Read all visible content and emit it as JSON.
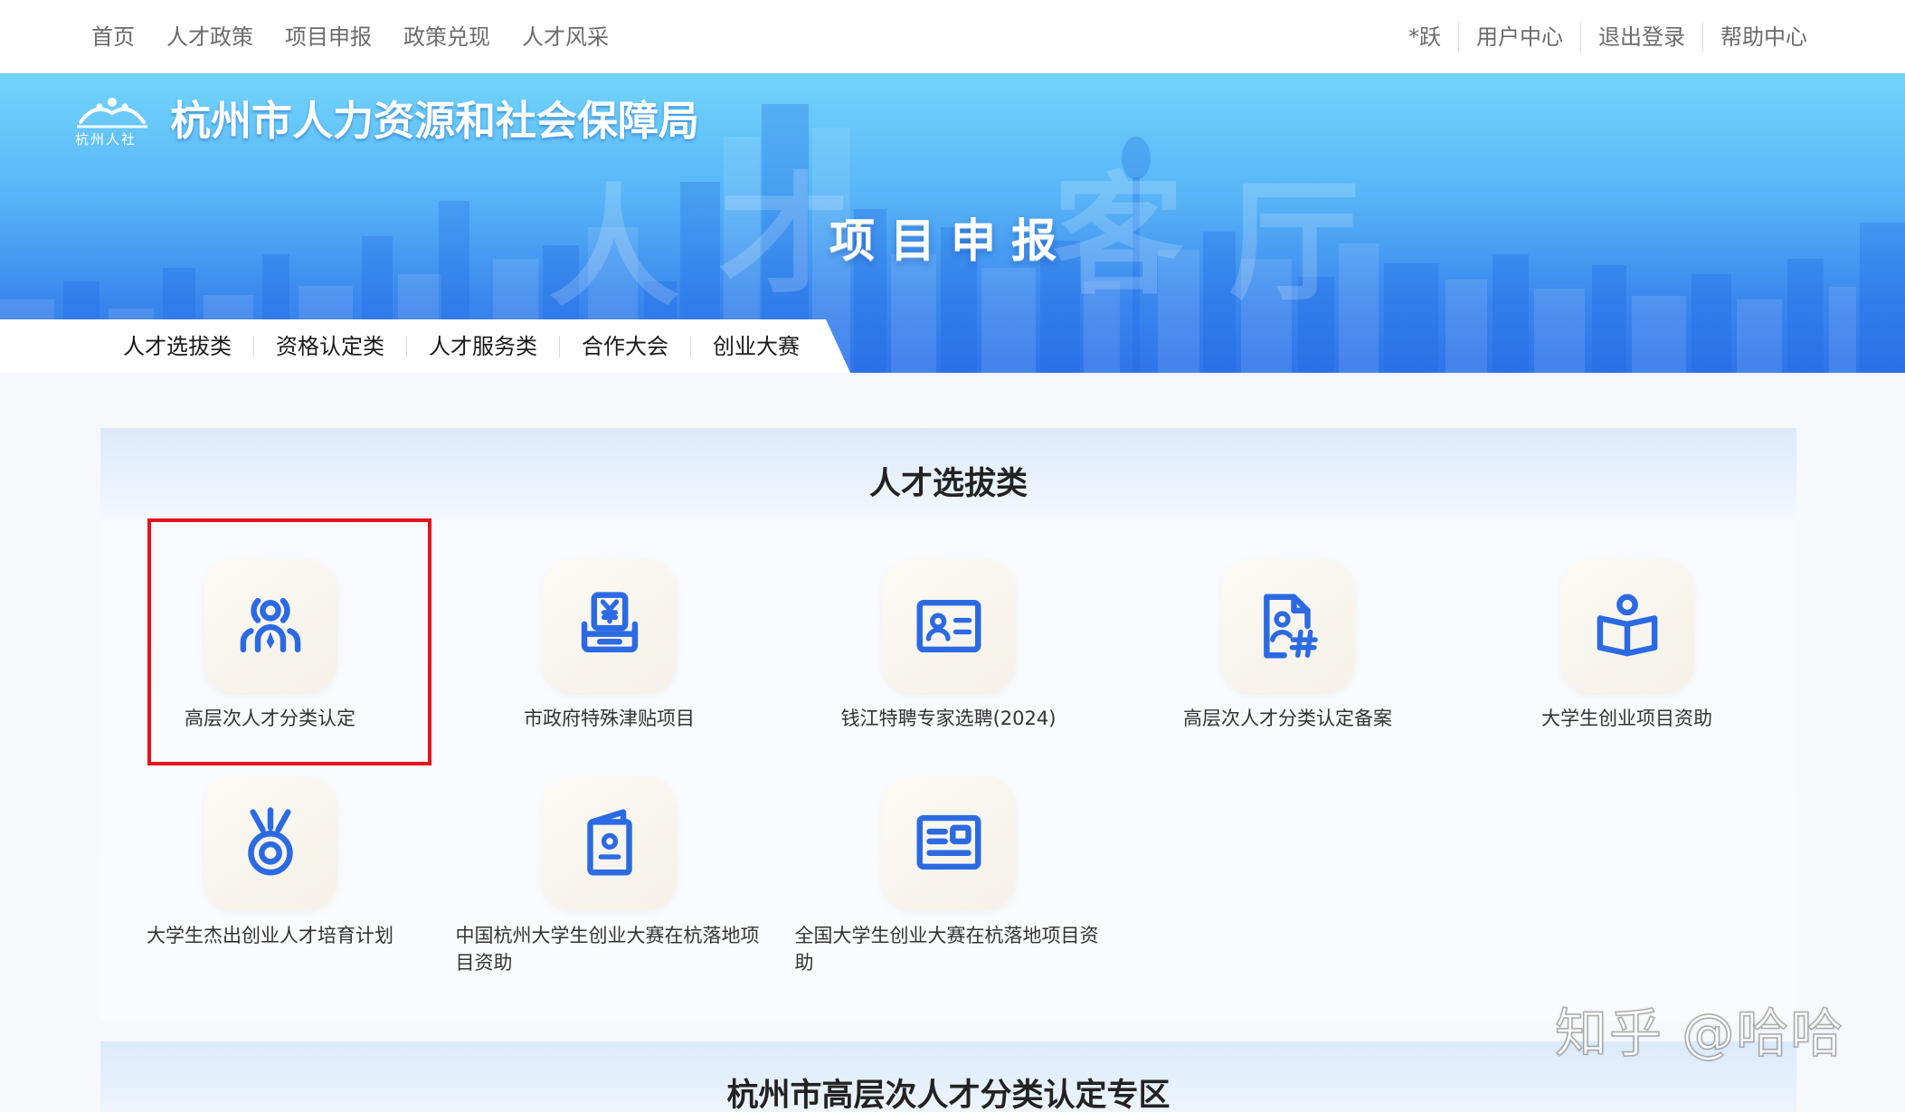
{
  "top_nav": {
    "left_items": [
      "首页",
      "人才政策",
      "项目申报",
      "政策兑现",
      "人才风采"
    ],
    "right_items": [
      "*跃",
      "用户中心",
      "退出登录",
      "帮助中心"
    ]
  },
  "banner": {
    "logo_text": "杭州人社",
    "org_title": "杭州市人力资源和社会保障局",
    "page_title": "项目申报",
    "watermark_chars": [
      "人",
      "才",
      "客",
      "厅"
    ]
  },
  "category_tabs": [
    "人才选拔类",
    "资格认定类",
    "人才服务类",
    "合作大会",
    "创业大赛"
  ],
  "talent_section": {
    "title": "人才选拔类",
    "items": [
      {
        "label": "高层次人才分类认定",
        "icon": "talent-group-icon"
      },
      {
        "label": "市政府特殊津贴项目",
        "icon": "yen-tray-icon"
      },
      {
        "label": "钱江特聘专家选聘(2024)",
        "icon": "id-card-icon"
      },
      {
        "label": "高层次人才分类认定备案",
        "icon": "document-person-hash-icon"
      },
      {
        "label": "大学生创业项目资助",
        "icon": "book-reader-icon"
      },
      {
        "label": "大学生杰出创业人才培育计划",
        "icon": "medal-icon"
      },
      {
        "label": "中国杭州大学生创业大赛在杭落地项目资助",
        "icon": "passport-icon"
      },
      {
        "label": "全国大学生创业大赛在杭落地项目资助",
        "icon": "news-board-icon"
      }
    ]
  },
  "zone_section": {
    "title": "杭州市高层次人才分类认定专区"
  },
  "watermark": "知乎 @哈哈",
  "colors": {
    "accent": "#2c6ae3",
    "highlight": "#e5141c",
    "banner_top": "#72d4fb",
    "banner_bottom": "#2f74ea"
  }
}
